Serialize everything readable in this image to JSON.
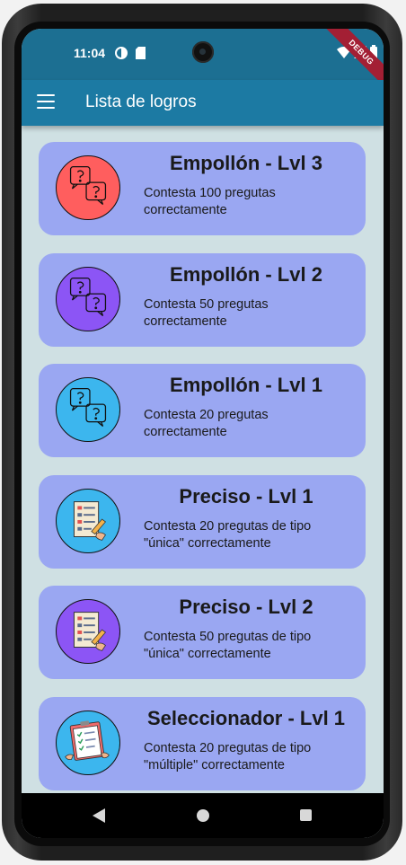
{
  "status_bar": {
    "time": "11:04",
    "debug_label": "DEBUG"
  },
  "app_bar": {
    "title": "Lista de logros"
  },
  "achievements": [
    {
      "title": "Empollón - Lvl 3",
      "description": "Contesta 100 pregutas correctamente",
      "icon": "question-bubbles-icon",
      "badge_color": "#ff5e5e"
    },
    {
      "title": "Empollón - Lvl 2",
      "description": "Contesta 50 pregutas correctamente",
      "icon": "question-bubbles-icon",
      "badge_color": "#8c55f5"
    },
    {
      "title": "Empollón - Lvl 1",
      "description": "Contesta 20 pregutas correctamente",
      "icon": "question-bubbles-icon",
      "badge_color": "#3cb6ee"
    },
    {
      "title": "Preciso - Lvl 1",
      "description": "Contesta 20 pregutas de tipo \"única\" correctamente",
      "icon": "test-sheet-icon",
      "badge_color": "#3cb6ee"
    },
    {
      "title": "Preciso - Lvl 2",
      "description": "Contesta 50 pregutas de tipo \"única\" correctamente",
      "icon": "test-sheet-icon",
      "badge_color": "#8c55f5"
    },
    {
      "title": "Seleccionador - Lvl 1",
      "description": "Contesta 20 pregutas de tipo \"múltiple\" correctamente",
      "icon": "clipboard-checklist-icon",
      "badge_color": "#3cb6ee"
    }
  ],
  "colors": {
    "status_bar": "#1c6f92",
    "app_bar": "#1c7aa3",
    "background": "#cfe0e3",
    "card": "#9aa7f2"
  }
}
